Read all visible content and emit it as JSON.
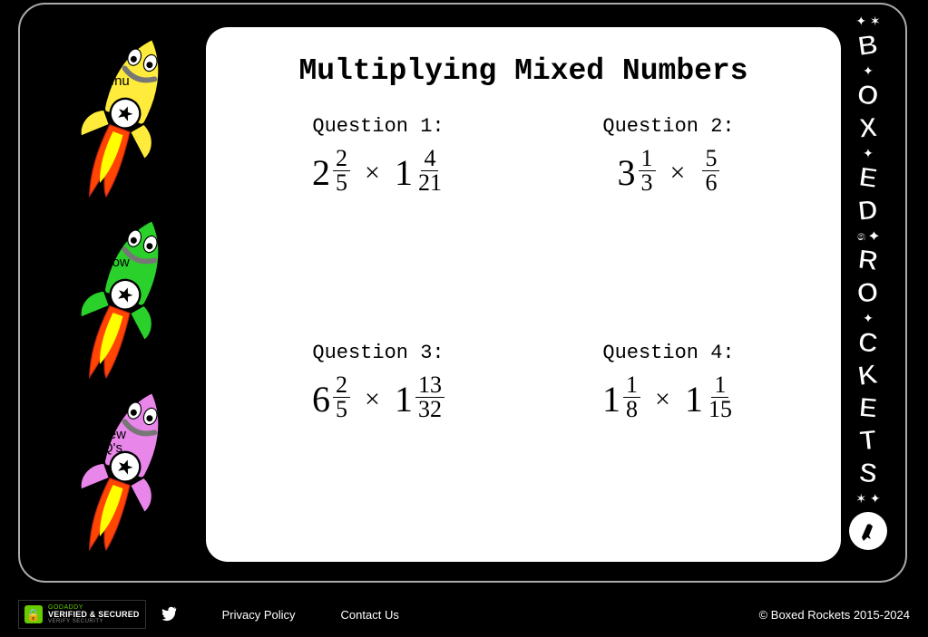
{
  "title": "Multiplying Mixed Numbers",
  "sidebar": {
    "menu_label": "Menu",
    "show_label": "Show",
    "newqs_label": "New\nQ's"
  },
  "brand_letters": [
    "B",
    "O",
    "X",
    "E",
    "D",
    "R",
    "O",
    "C",
    "K",
    "E",
    "T",
    "S"
  ],
  "questions": [
    {
      "label": "Question 1:",
      "left": {
        "whole": "2",
        "num": "2",
        "den": "5"
      },
      "right": {
        "whole": "1",
        "num": "4",
        "den": "21"
      }
    },
    {
      "label": "Question 2:",
      "left": {
        "whole": "3",
        "num": "1",
        "den": "3"
      },
      "right": {
        "whole": "",
        "num": "5",
        "den": "6"
      }
    },
    {
      "label": "Question 3:",
      "left": {
        "whole": "6",
        "num": "2",
        "den": "5"
      },
      "right": {
        "whole": "1",
        "num": "13",
        "den": "32"
      }
    },
    {
      "label": "Question 4:",
      "left": {
        "whole": "1",
        "num": "1",
        "den": "8"
      },
      "right": {
        "whole": "1",
        "num": "1",
        "den": "15"
      }
    }
  ],
  "footer": {
    "verified_top": "GODADDY",
    "verified_mid": "VERIFIED & SECURED",
    "verified_bot": "VERIFY SECURITY",
    "privacy": "Privacy Policy",
    "contact": "Contact Us",
    "copyright": "© Boxed Rockets 2015-2024"
  }
}
